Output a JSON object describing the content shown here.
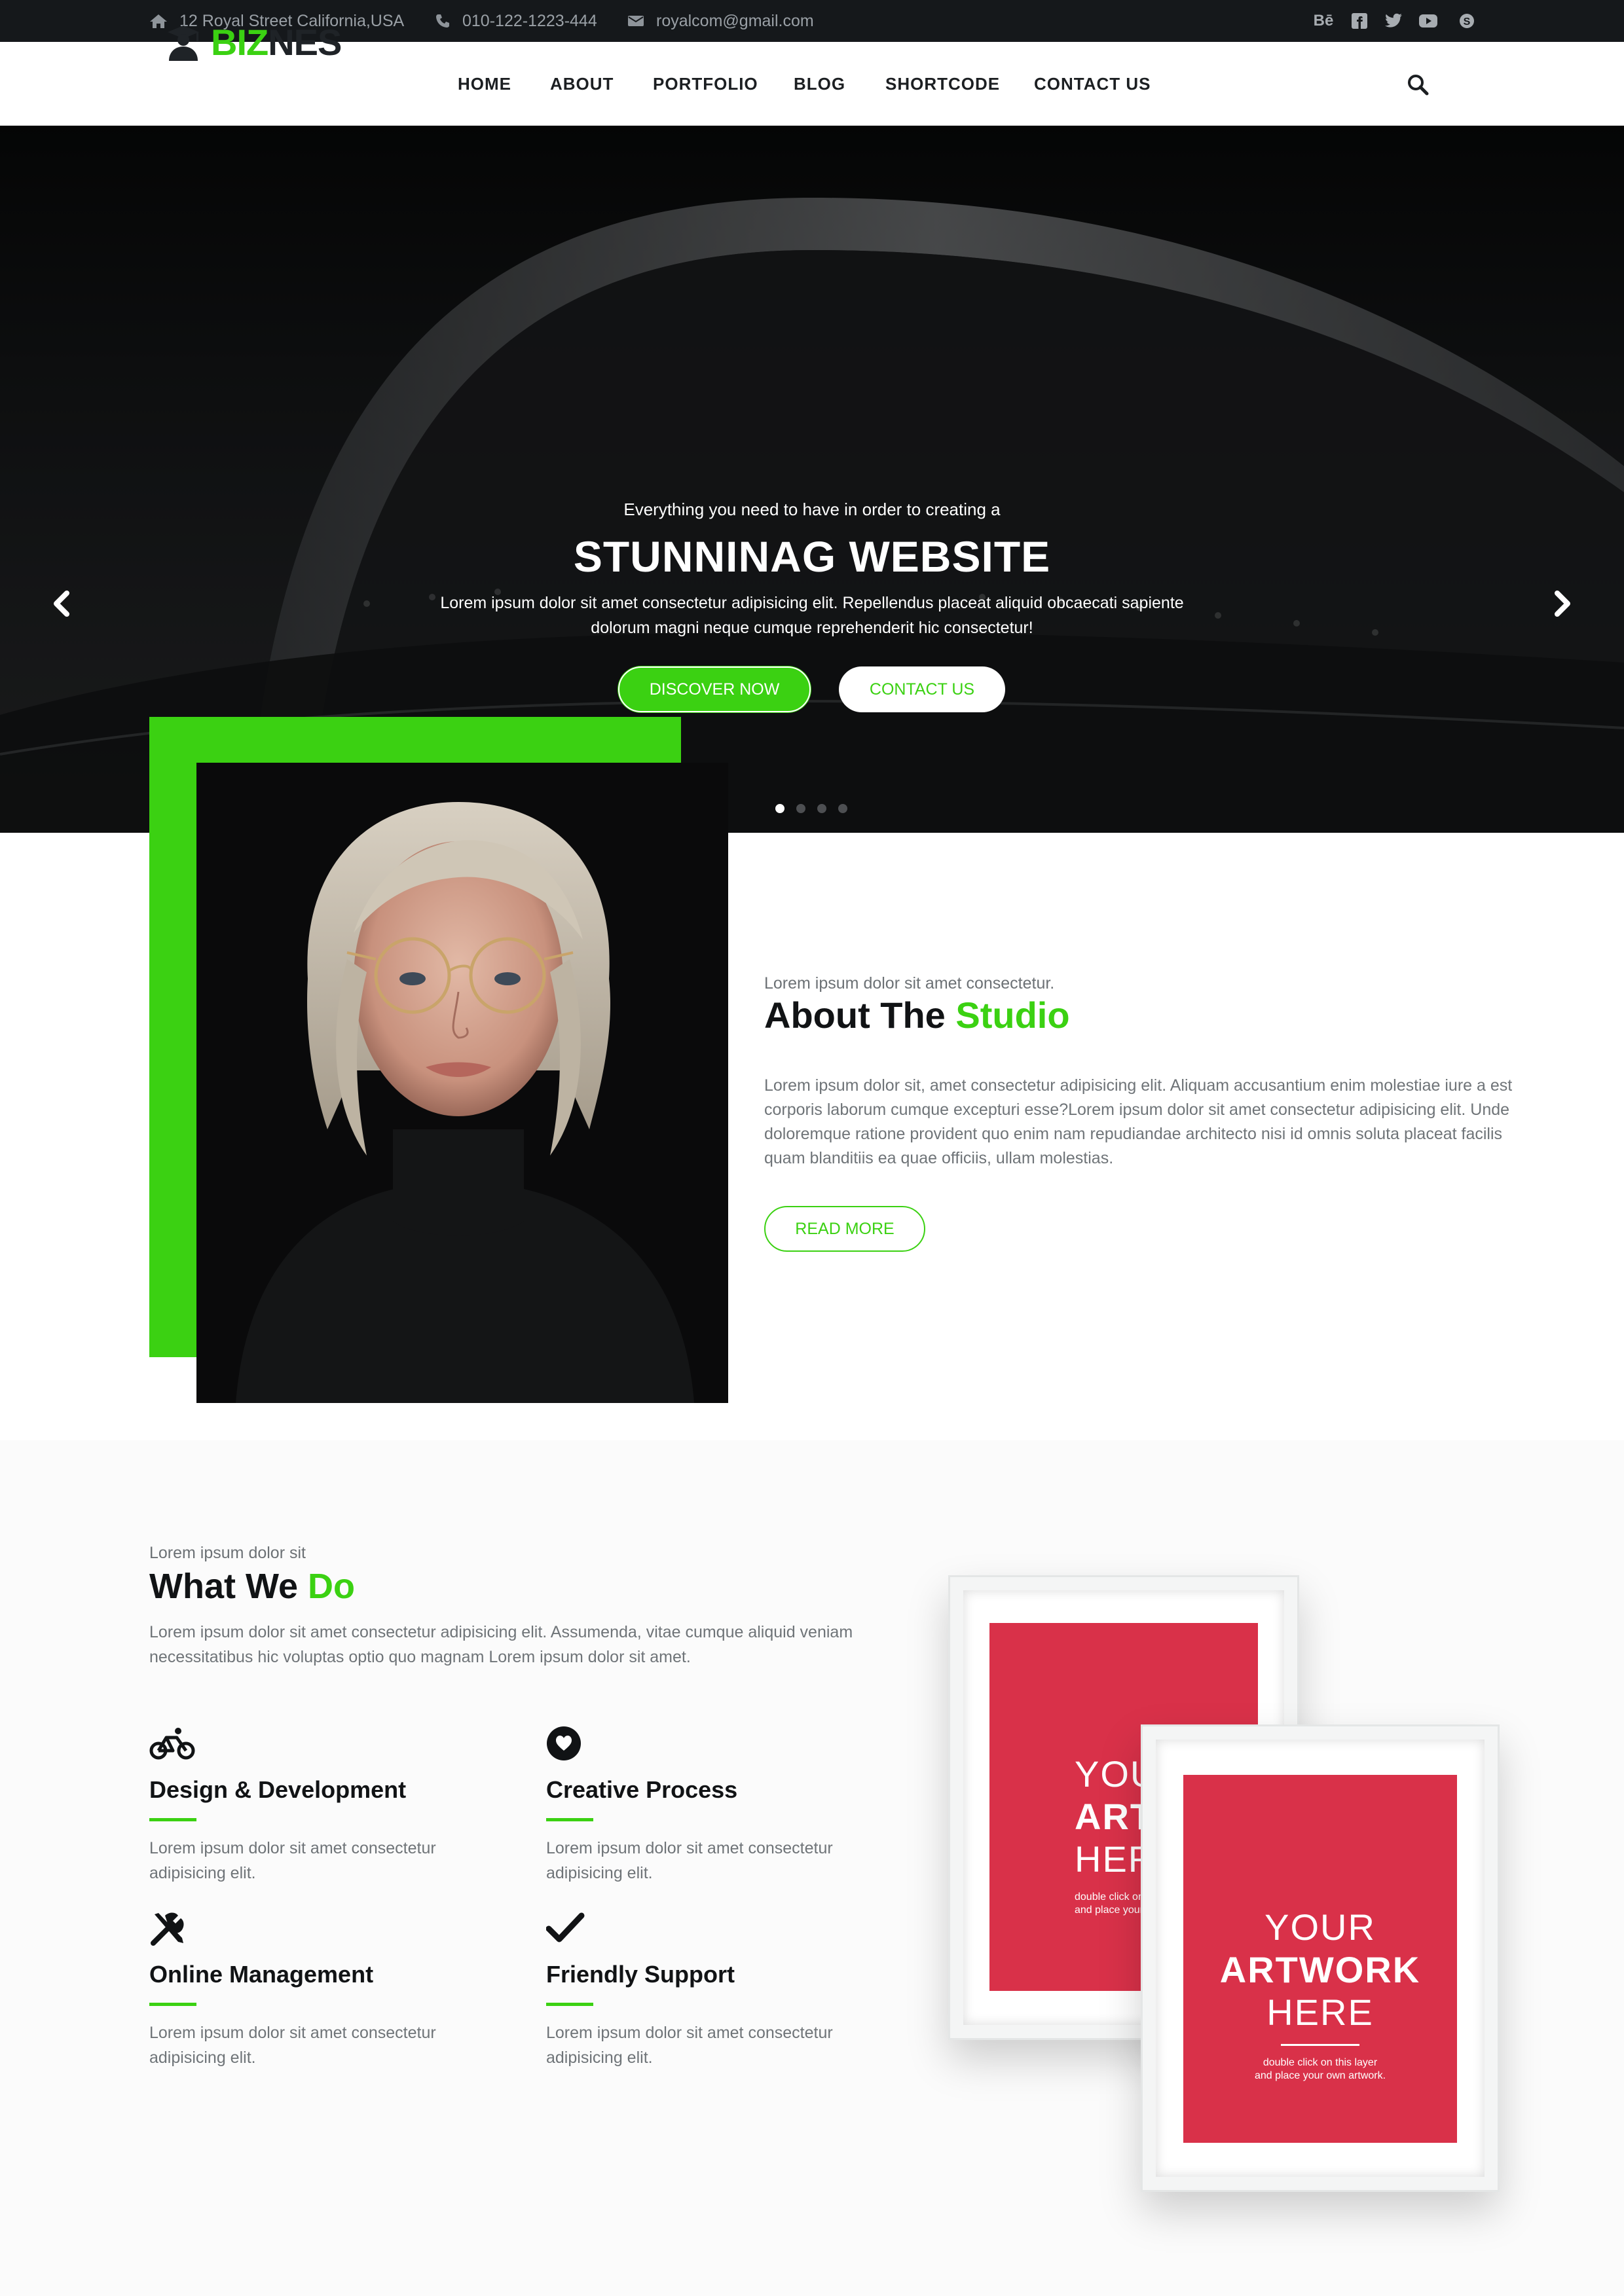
{
  "topbar": {
    "address": "12 Royal Street California,USA",
    "phone": "010-122-1223-444",
    "email": "royalcom@gmail.com",
    "social": [
      "behance-icon",
      "facebook-icon",
      "twitter-icon",
      "youtube-icon",
      "skype-icon"
    ],
    "behance_label": "Bē"
  },
  "brand": {
    "name_part1": "BIZ",
    "name_part2": "NES",
    "accent": "#3bd112"
  },
  "nav": {
    "home": "HOME",
    "about": "ABOUT",
    "portfolio": "PORTFOLIO",
    "blog": "BLOG",
    "shortcode": "SHORTCODE",
    "contact": "CONTACT US"
  },
  "hero": {
    "subtitle": "Everything you need to have in order to creating a",
    "title": "STUNNINAG WEBSITE",
    "desc_line1": "Lorem ipsum dolor sit amet consectetur adipisicing elit. Repellendus placeat aliquid obcaecati sapiente",
    "desc_line2": "dolorum magni neque cumque reprehenderit hic consectetur!",
    "primary_button": "DISCOVER NOW",
    "secondary_button": "CONTACT US",
    "slides_total": 4,
    "active_slide": 1
  },
  "about": {
    "kicker": "Lorem ipsum dolor sit amet consectetur.",
    "title_part1": "About The ",
    "title_part2": "Studio",
    "body": "Lorem ipsum dolor sit, amet consectetur adipisicing elit. Aliquam accusantium enim molestiae iure a est corporis laborum cumque excepturi esse?Lorem ipsum dolor sit amet consectetur adipisicing elit. Unde doloremque ratione provident quo enim nam repudiandae architecto nisi id omnis soluta placeat facilis quam blanditiis ea quae officiis, ullam molestias.",
    "button": "READ MORE"
  },
  "services": {
    "kicker": "Lorem ipsum dolor sit",
    "title_part1": "What We ",
    "title_part2": "Do",
    "desc": "Lorem ipsum dolor sit amet consectetur adipisicing elit. Assumenda, vitae cumque aliquid veniam necessitatibus hic voluptas optio quo magnam Lorem ipsum dolor sit amet.",
    "items": [
      {
        "icon": "bicycle-icon",
        "title": "Design & Development",
        "text": "Lorem ipsum dolor sit amet consectetur adipisicing elit."
      },
      {
        "icon": "heart-icon",
        "title": "Creative Process",
        "text": "Lorem ipsum dolor sit amet consectetur adipisicing elit."
      },
      {
        "icon": "tools-icon",
        "title": "Online Management",
        "text": "Lorem ipsum dolor sit amet consectetur adipisicing elit."
      },
      {
        "icon": "check-icon",
        "title": "Friendly Support",
        "text": "Lorem ipsum dolor sit amet consectetur adipisicing elit."
      }
    ]
  },
  "artwork": {
    "line1": "YOUR",
    "line2": "ARTWORK",
    "line3": "HERE",
    "small1": "double click on this layer",
    "small2": "and place your own artwork.",
    "back_line2": "ARTWO",
    "back_line3": "HER",
    "back_small1": "double click on th",
    "back_small2": "and place your ow"
  }
}
